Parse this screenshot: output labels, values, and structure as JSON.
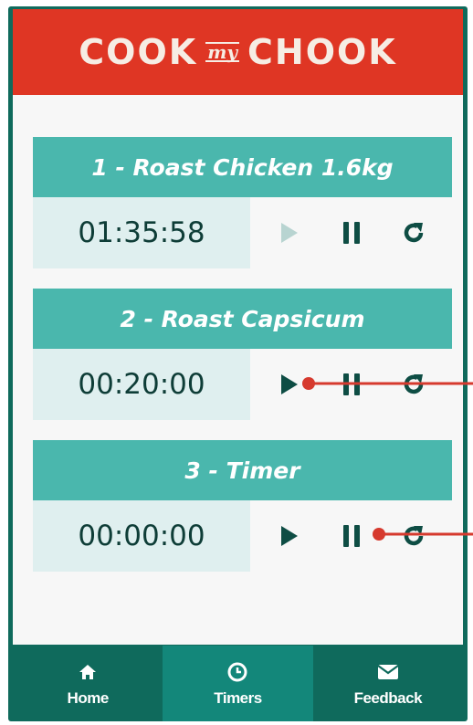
{
  "header": {
    "logo_left": "COOK",
    "logo_middle": "my",
    "logo_right": "CHOOK"
  },
  "timers": [
    {
      "title": "1 - Roast Chicken 1.6kg",
      "time": "01:35:58",
      "play_enabled": false
    },
    {
      "title": "2 - Roast Capsicum",
      "time": "00:20:00",
      "play_enabled": true
    },
    {
      "title": "3 - Timer",
      "time": "00:00:00",
      "play_enabled": true
    }
  ],
  "nav": {
    "items": [
      {
        "label": "Home",
        "icon": "home-icon"
      },
      {
        "label": "Timers",
        "icon": "clock-icon",
        "active": true
      },
      {
        "label": "Feedback",
        "icon": "envelope-icon"
      }
    ]
  },
  "colors": {
    "header_bg": "#df3624",
    "card_title_bg": "#4ab7ad",
    "time_bg": "#dfefef",
    "nav_bg": "#0f6a5c",
    "nav_active_bg": "#13877a",
    "icon_dark": "#0e4d44",
    "icon_disabled": "#b8d4d1",
    "annotation_red": "#d63a2e"
  }
}
